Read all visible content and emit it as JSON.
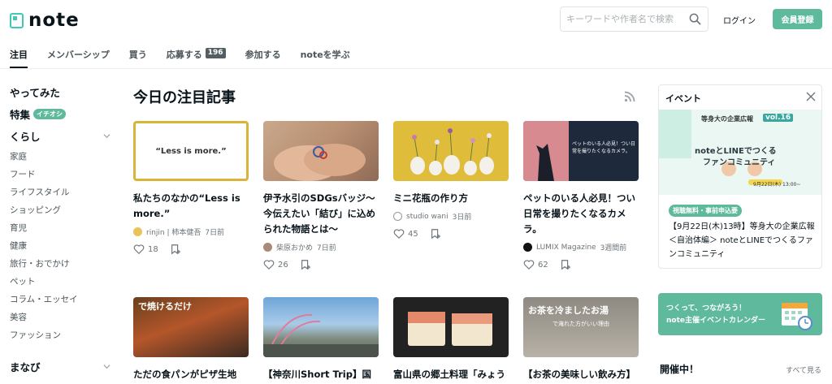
{
  "header": {
    "logo_text": "note",
    "search_placeholder": "キーワードや作者名で検索",
    "login_label": "ログイン",
    "signup_label": "会員登録"
  },
  "tabs": [
    {
      "label": "注目",
      "active": true
    },
    {
      "label": "メンバーシップ"
    },
    {
      "label": "買う"
    },
    {
      "label": "応募する",
      "count": "196"
    },
    {
      "label": "参加する"
    },
    {
      "label": "noteを学ぶ"
    }
  ],
  "sidebar": {
    "headings": [
      {
        "label": "やってみた"
      },
      {
        "label": "特集",
        "tag": "イチオシ"
      },
      {
        "label": "くらし"
      }
    ],
    "items": [
      "家庭",
      "フード",
      "ライフスタイル",
      "ショッピング",
      "育児",
      "健康",
      "旅行・おでかけ",
      "ペット",
      "コラム・エッセイ",
      "美容",
      "ファッション"
    ],
    "section2": "まなび"
  },
  "main": {
    "title": "今日の注目記事",
    "cards": [
      {
        "title": "私たちのなかの“Less is more.”",
        "thumb_text": "“Less is more.”",
        "author": "rinjin | 柿本健吾",
        "time": "7日前",
        "likes": "18"
      },
      {
        "title": "伊予水引のSDGsバッジ〜今伝えたい「結び」に込められた物語とは〜",
        "author": "柴原おかめ",
        "time": "7日前",
        "likes": "26"
      },
      {
        "title": "ミニ花瓶の作り方",
        "author": "studio wani",
        "time": "3日前",
        "likes": "45"
      },
      {
        "title": "ペットのいる人必見！つい日常を撮りたくなるカメラ。",
        "thumb_text": "ペットのいる人必見！つい日常を撮りたくなるカメラ。",
        "author": "LUMIX Magazine",
        "time": "3週間前",
        "likes": "62"
      },
      {
        "title": "ただの食パンがピザ生地",
        "thumb_text": "で焼けるだけ"
      },
      {
        "title": "【神奈川Short Trip】国内"
      },
      {
        "title": "富山県の郷土料理「みょう"
      },
      {
        "title": "【お茶の美味しい飲み方】",
        "thumb_text": "お茶を冷ましたお湯",
        "thumb_sub": "で淹れた方がいい理由"
      }
    ]
  },
  "event": {
    "heading": "イベント",
    "banner_line1": "等身大の企業広報",
    "banner_vol": "vol.16",
    "banner_line2": "noteとLINEでつくる",
    "banner_line3": "ファンコミュニティ",
    "banner_date": "9月22日(木) 13:00~",
    "tag": "視聴無料・事前申込要",
    "text": "【9月22日(木)13時】等身大の企業広報＜自治体編＞ noteとLINEでつくるファンコミュニティ"
  },
  "calendar": {
    "line1": "つくって、つながろう！",
    "line2": "note主催イベントカレンダー"
  },
  "now": {
    "heading": "開催中！",
    "see_all": "すべて見る"
  },
  "colors": {
    "accent": "#5fb99c",
    "logo": "#41c9b4"
  }
}
